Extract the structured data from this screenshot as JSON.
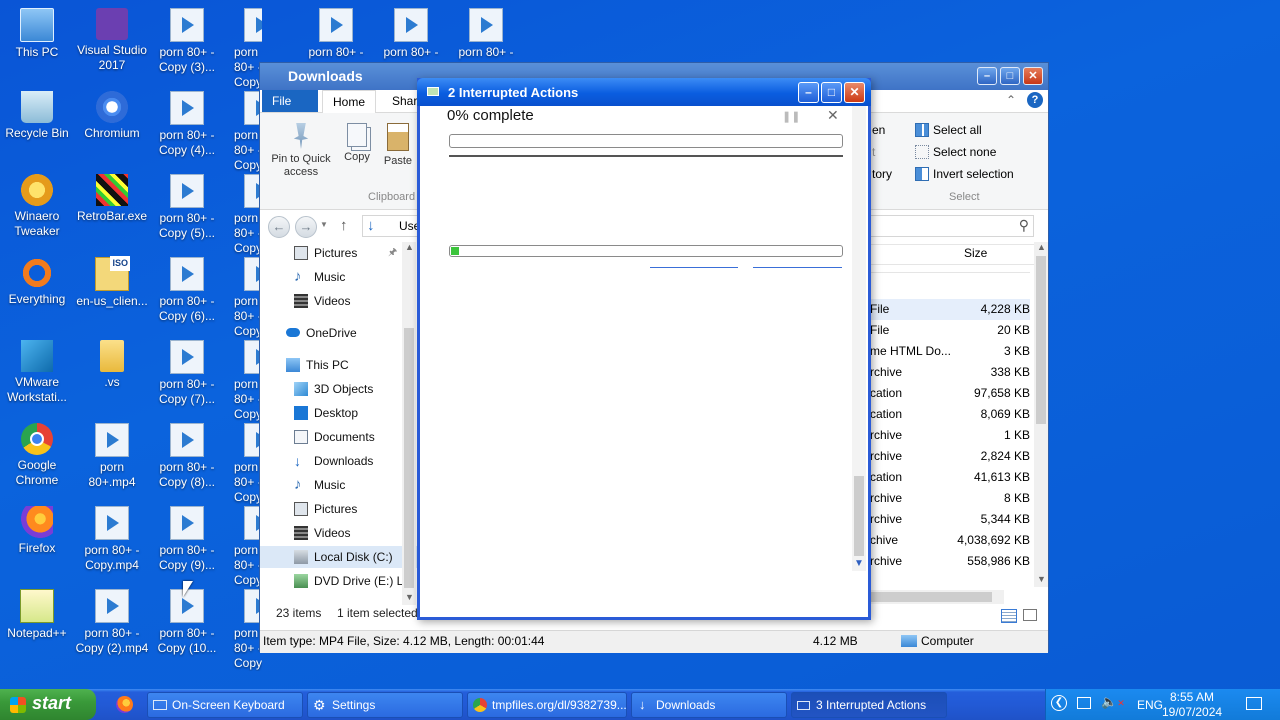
{
  "desktop": {
    "icons": [
      {
        "label": "This PC"
      },
      {
        "label": "Visual Studio 2017"
      },
      {
        "label": "porn 80+ - Copy (3)..."
      },
      {
        "label": "porn 80+ - Copy"
      },
      {
        "label": "porn 80+ -"
      },
      {
        "label": "porn 80+ -"
      },
      {
        "label": "porn 80+ -"
      },
      {
        "label": "Recycle Bin"
      },
      {
        "label": "Chromium"
      },
      {
        "label": "porn 80+ - Copy (4)..."
      },
      {
        "label": "porn 80+ - Copy"
      },
      {
        "label": "Winaero Tweaker"
      },
      {
        "label": "RetroBar.exe"
      },
      {
        "label": "porn 80+ - Copy (5)..."
      },
      {
        "label": "porn 80+ - Copy"
      },
      {
        "label": "Everything"
      },
      {
        "label": "en-us_clien..."
      },
      {
        "label": "porn 80+ - Copy (6)..."
      },
      {
        "label": "porn 80+ - Copy"
      },
      {
        "label": "VMware Workstati..."
      },
      {
        "label": ".vs"
      },
      {
        "label": "porn 80+ - Copy (7)..."
      },
      {
        "label": "porn 80+ - Copy"
      },
      {
        "label": "Google Chrome"
      },
      {
        "label": "porn 80+.mp4"
      },
      {
        "label": "porn 80+ - Copy (8)..."
      },
      {
        "label": "porn 80+ - Copy"
      },
      {
        "label": "Firefox"
      },
      {
        "label": "porn 80+ - Copy.mp4"
      },
      {
        "label": "porn 80+ - Copy (9)..."
      },
      {
        "label": "porn 80+ - Copy"
      },
      {
        "label": "Notepad++"
      },
      {
        "label": "porn 80+ - Copy (2).mp4"
      },
      {
        "label": "porn 80+ - Copy (10..."
      },
      {
        "label": "porn 80+ - Copy"
      }
    ]
  },
  "explorer": {
    "title": "Downloads",
    "tabs": {
      "file": "File",
      "home": "Home",
      "share": "Share"
    },
    "ribbon": {
      "pin": "Pin to Quick access",
      "copy": "Copy",
      "paste": "Paste",
      "clipboard": "Clipboard",
      "open_partial": "en",
      "t_partial": "t",
      "history_partial": "tory",
      "select_all": "Select all",
      "select_none": "Select none",
      "invert": "Invert selection",
      "select_group": "Select"
    },
    "address": "Use",
    "nav": [
      {
        "label": "Pictures"
      },
      {
        "label": "Music"
      },
      {
        "label": "Videos"
      },
      {
        "label": "OneDrive"
      },
      {
        "label": "This PC"
      },
      {
        "label": "3D Objects"
      },
      {
        "label": "Desktop"
      },
      {
        "label": "Documents"
      },
      {
        "label": "Downloads"
      },
      {
        "label": "Music"
      },
      {
        "label": "Pictures"
      },
      {
        "label": "Videos"
      },
      {
        "label": "Local Disk (C:)"
      },
      {
        "label": "DVD Drive (E:) L1"
      }
    ],
    "size_header": "Size",
    "rows": [
      {
        "type": "File",
        "size": "4,228 KB"
      },
      {
        "type": "File",
        "size": "20 KB"
      },
      {
        "type": "me HTML Do...",
        "size": "3 KB"
      },
      {
        "type": "rchive",
        "size": "338 KB"
      },
      {
        "type": "cation",
        "size": "97,658 KB"
      },
      {
        "type": "cation",
        "size": "8,069 KB"
      },
      {
        "type": "rchive",
        "size": "1 KB"
      },
      {
        "type": "rchive",
        "size": "2,824 KB"
      },
      {
        "type": "cation",
        "size": "41,613 KB"
      },
      {
        "type": "rchive",
        "size": "8 KB"
      },
      {
        "type": "rchive",
        "size": "5,344 KB"
      },
      {
        "type": "chive",
        "size": "4,038,692 KB"
      },
      {
        "type": "rchive",
        "size": "558,986 KB"
      }
    ],
    "status": {
      "items": "23 items",
      "selected": "1 item selected"
    },
    "info": {
      "text": "Item type: MP4 File, Size: 4.12 MB, Length: 00:01:44",
      "size": "4.12 MB",
      "location": "Computer"
    }
  },
  "dialog": {
    "title": "2 Interrupted Actions",
    "progress_text": "0% complete",
    "progress": {
      "top": 0,
      "bottom": 0.02
    }
  },
  "taskbar": {
    "start": "start",
    "tasks": [
      {
        "label": "On-Screen Keyboard"
      },
      {
        "label": "Settings"
      },
      {
        "label": "tmpfiles.org/dl/9382739..."
      },
      {
        "label": "Downloads"
      },
      {
        "label": "3 Interrupted Actions"
      }
    ],
    "lang": "ENG",
    "time": "8:55 AM",
    "date": "19/07/2024"
  },
  "colors": {
    "desktop": "#0a5bd4",
    "xp_blue": "#0a5de0",
    "start_green": "#3a9a3a",
    "progress_green": "#3cc43c"
  }
}
